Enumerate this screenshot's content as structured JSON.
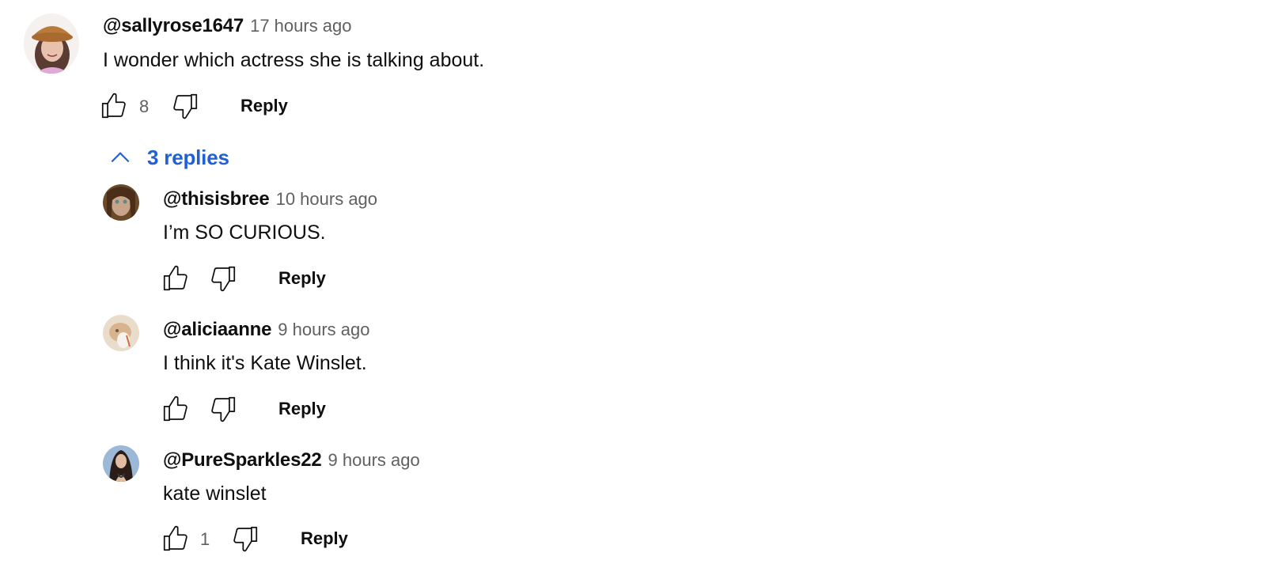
{
  "comment": {
    "author": "@sallyrose1647",
    "time": "17 hours ago",
    "text": "I wonder which actress she is talking about.",
    "likes": "8",
    "reply_label": "Reply"
  },
  "replies_toggle": {
    "label": "3 replies"
  },
  "replies": [
    {
      "author": "@thisisbree",
      "time": "10 hours ago",
      "text": "I’m SO CURIOUS.",
      "likes": "",
      "reply_label": "Reply"
    },
    {
      "author": "@aliciaanne",
      "time": "9 hours ago",
      "text": "I think it's Kate Winslet.",
      "likes": "",
      "reply_label": "Reply"
    },
    {
      "author": "@PureSparkles22",
      "time": "9 hours ago",
      "text": "kate winslet",
      "likes": "1",
      "reply_label": "Reply"
    }
  ],
  "icons": {
    "like": "thumbs-up-icon",
    "dislike": "thumbs-down-icon",
    "collapse": "chevron-up-icon"
  },
  "colors": {
    "text": "#0f0f0f",
    "secondary": "#606060",
    "link": "#1f5fd8"
  }
}
